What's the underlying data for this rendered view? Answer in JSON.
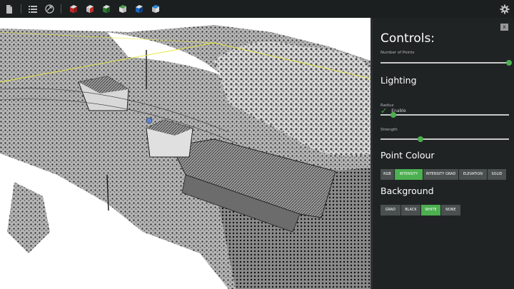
{
  "toolbar": {
    "icons": [
      "document-icon",
      "list-icon",
      "share-icon",
      "cube-red-icon",
      "cube-red2-icon",
      "cube-green-icon",
      "cube-green2-icon",
      "cube-blue-icon",
      "cube-blue2-icon"
    ],
    "settings_icon": "gear-icon"
  },
  "controls": {
    "title": "Controls:",
    "close_label": "x",
    "number_of_points_label": "Number of Points",
    "number_of_points_value": 1.0,
    "lighting": {
      "title": "Lighting",
      "enable_label": "Enable",
      "enabled": true,
      "radius_label": "Radius",
      "radius_value": 0.1,
      "strength_label": "Strength",
      "strength_value": 0.31
    },
    "point_colour": {
      "title": "Point Colour",
      "options": [
        "RGB",
        "INTENSITY",
        "INTENSITY GRAD",
        "ELEVATION",
        "SOLID"
      ],
      "selected": "INTENSITY"
    },
    "background": {
      "title": "Background",
      "options": [
        "GRAD",
        "BLACK",
        "WHITE",
        "NONE"
      ],
      "selected": "WHITE"
    },
    "accent_color": "#4caf50"
  }
}
